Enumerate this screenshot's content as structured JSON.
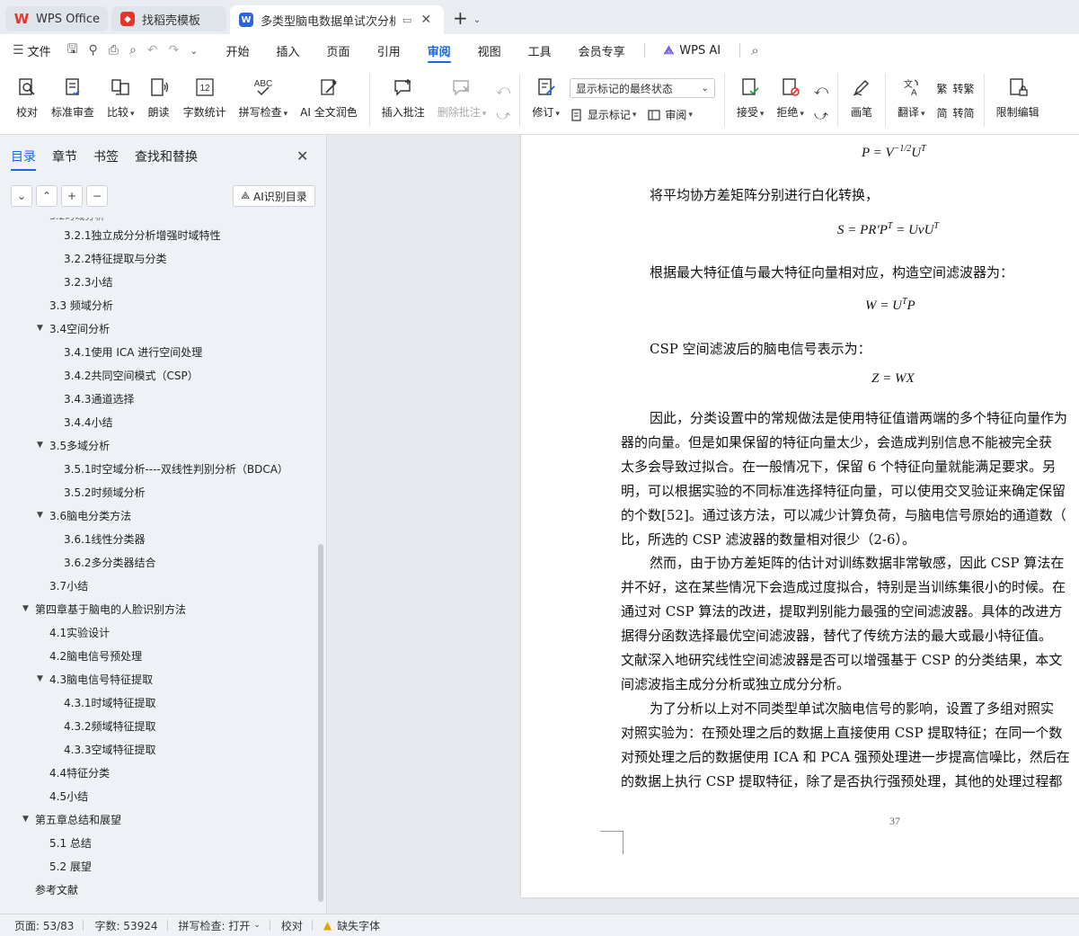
{
  "tabs": [
    {
      "label": "WPS Office",
      "icon": "wps-logo-icon",
      "color": "#e8332b"
    },
    {
      "label": "找稻壳模板",
      "icon": "docer-icon",
      "color": "#e8332b"
    },
    {
      "label": "多类型脑电数据单试次分析的",
      "icon": "writer-icon",
      "color": "#2b63e8"
    }
  ],
  "menu": {
    "file": "文件",
    "items": [
      "开始",
      "插入",
      "页面",
      "引用",
      "审阅",
      "视图",
      "工具",
      "会员专享"
    ],
    "active": "审阅",
    "wps_ai": "WPS AI"
  },
  "ribbon": {
    "proofread": "校对",
    "standard_review": "标准审查",
    "compare": "比较",
    "read_aloud": "朗读",
    "word_count": "字数统计",
    "spell_check": "拼写检查",
    "ai_polish": "AI 全文润色",
    "insert_comment": "插入批注",
    "delete_comment": "删除批注",
    "revise": "修订",
    "display_select": "显示标记的最终状态",
    "show_markup": "显示标记",
    "review": "审阅",
    "accept": "接受",
    "reject": "拒绝",
    "pen": "画笔",
    "translate": "翻译",
    "to_traditional": "转繁",
    "to_simplified": "转简",
    "restrict_edit": "限制编辑",
    "word_count_icon_text": "12",
    "spell_icon_text": "ABC"
  },
  "nav": {
    "tabs": [
      "目录",
      "章节",
      "书签",
      "查找和替换"
    ],
    "active_tab": "目录",
    "ai_toc": "AI识别目录",
    "toc": [
      {
        "text": "3.2.1独立成分分析增强时域特性",
        "level": 3,
        "arrow": false
      },
      {
        "text": "3.2.2特征提取与分类",
        "level": 3,
        "arrow": false
      },
      {
        "text": "3.2.3小结",
        "level": 3,
        "arrow": false
      },
      {
        "text": "3.3  频域分析",
        "level": 2,
        "arrow": false
      },
      {
        "text": "3.4空间分析",
        "level": 2,
        "arrow": true
      },
      {
        "text": "3.4.1使用 ICA 进行空间处理",
        "level": 3,
        "arrow": false
      },
      {
        "text": "3.4.2共同空间模式（CSP）",
        "level": 3,
        "arrow": false
      },
      {
        "text": "3.4.3通道选择",
        "level": 3,
        "arrow": false
      },
      {
        "text": "3.4.4小结",
        "level": 3,
        "arrow": false
      },
      {
        "text": "3.5多域分析",
        "level": 2,
        "arrow": true
      },
      {
        "text": "3.5.1时空域分析----双线性判别分析（BDCA）",
        "level": 3,
        "arrow": false
      },
      {
        "text": "3.5.2时频域分析",
        "level": 3,
        "arrow": false
      },
      {
        "text": "3.6脑电分类方法",
        "level": 2,
        "arrow": true
      },
      {
        "text": "3.6.1线性分类器",
        "level": 3,
        "arrow": false
      },
      {
        "text": "3.6.2多分类器结合",
        "level": 3,
        "arrow": false
      },
      {
        "text": "3.7小结",
        "level": 2,
        "arrow": false
      },
      {
        "text": "第四章基于脑电的人脸识别方法",
        "level": 1,
        "arrow": true
      },
      {
        "text": "4.1实验设计",
        "level": 2,
        "arrow": false
      },
      {
        "text": "4.2脑电信号预处理",
        "level": 2,
        "arrow": false
      },
      {
        "text": "4.3脑电信号特征提取",
        "level": 2,
        "arrow": true
      },
      {
        "text": "4.3.1时域特征提取",
        "level": 3,
        "arrow": false
      },
      {
        "text": "4.3.2频域特征提取",
        "level": 3,
        "arrow": false
      },
      {
        "text": "4.3.3空域特征提取",
        "level": 3,
        "arrow": false
      },
      {
        "text": "4.4特征分类",
        "level": 2,
        "arrow": false
      },
      {
        "text": "4.5小结",
        "level": 2,
        "arrow": false
      },
      {
        "text": "第五章总结和展望",
        "level": 1,
        "arrow": true
      },
      {
        "text": "5.1  总结",
        "level": 2,
        "arrow": false
      },
      {
        "text": "5.2  展望",
        "level": 2,
        "arrow": false
      },
      {
        "text": "参考文献",
        "level": 1,
        "arrow": false
      }
    ]
  },
  "document": {
    "formula1": "P = V",
    "formula1_sup": "−1/2",
    "formula1_tail": "U",
    "formula1_tail_sup": "T",
    "para1": "将平均协方差矩阵分别进行白化转换，",
    "formula2": "S = PR′P",
    "formula2_sup": "T",
    "formula2_mid": " = UvU",
    "formula2_sup2": "T",
    "para2": "根据最大特征值与最大特征向量相对应，构造空间滤波器为：",
    "formula3": "W = U",
    "formula3_sup": "T",
    "formula3_tail": "P",
    "para3": "CSP 空间滤波后的脑电信号表示为：",
    "formula4": "Z = WX",
    "body_lines": [
      "因此，分类设置中的常规做法是使用特征值谱两端的多个特征向量作为",
      "器的向量。但是如果保留的特征向量太少，会造成判别信息不能被完全获",
      "太多会导致过拟合。在一般情况下，保留 6 个特征向量就能满足要求。另",
      "明，可以根据实验的不同标准选择特征向量，可以使用交叉验证来确定保留",
      "的个数[52]。通过该方法，可以减少计算负荷，与脑电信号原始的通道数（",
      "比，所选的 CSP 滤波器的数量相对很少（2-6）。",
      "然而，由于协方差矩阵的估计对训练数据非常敏感，因此 CSP 算法在",
      "并不好，这在某些情况下会造成过度拟合，特别是当训练集很小的时候。在",
      "通过对 CSP 算法的改进，提取判别能力最强的空间滤波器。具体的改进方",
      "据得分函数选择最优空间滤波器，替代了传统方法的最大或最小特征值。",
      "文献深入地研究线性空间滤波器是否可以增强基于 CSP 的分类结果，本文",
      "间滤波指主成分分析或独立成分分析。",
      "为了分析以上对不同类型单试次脑电信号的影响，设置了多组对照实",
      "对照实验为：在预处理之后的数据上直接使用 CSP 提取特征；在同一个数",
      "对预处理之后的数据使用 ICA 和 PCA 强预处理进一步提高信噪比，然后在",
      "的数据上执行 CSP 提取特征，除了是否执行强预处理，其他的处理过程都"
    ],
    "indent_lines": [
      0,
      6,
      12
    ],
    "page_number": "37"
  },
  "status": {
    "page": "页面: 53/83",
    "words": "字数: 53924",
    "spell": "拼写检查: 打开",
    "proof": "校对",
    "missing_font": "缺失字体"
  }
}
